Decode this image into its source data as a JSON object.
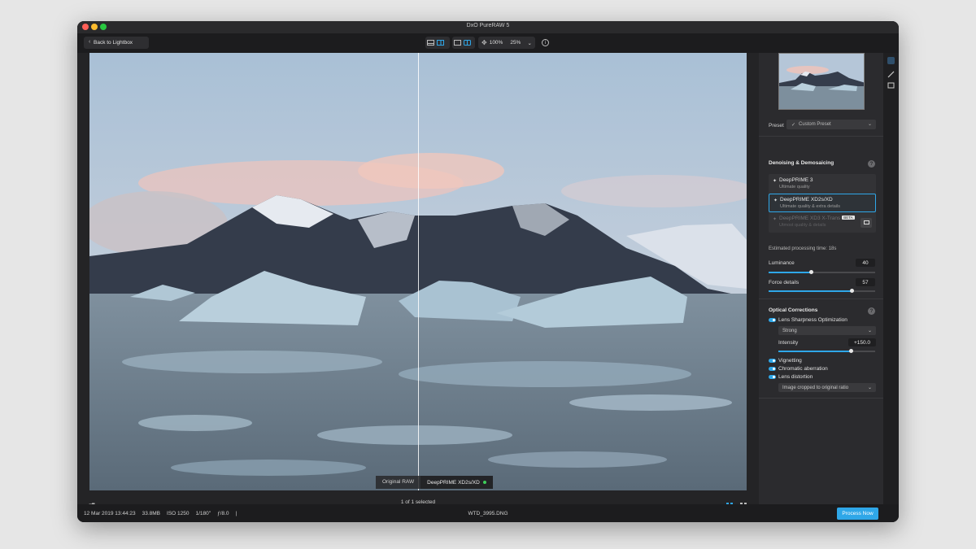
{
  "app": {
    "title": "DxO PureRAW 5"
  },
  "toolbar": {
    "back_label": "Back to Lightbox",
    "zoom_percent": "100%",
    "zoom_select": "25%"
  },
  "viewer": {
    "label_original": "Original RAW",
    "label_processed": "DeepPRIME XD2s/XD",
    "selection_count": "1 of 1 selected"
  },
  "panel": {
    "preset": {
      "label": "Preset",
      "value": "Custom Preset"
    },
    "denoising": {
      "title": "Denoising & Demosaicing",
      "options": [
        {
          "name": "DeepPRIME 3",
          "sub": "Ultimate quality"
        },
        {
          "name": "DeepPRIME XD2s/XD",
          "sub": "Ultimate quality & extra details"
        },
        {
          "name": "DeepPRIME XD3 X-Trans",
          "sub": "Utmost quality & details",
          "badge": "BETA"
        }
      ],
      "estimated_time_label": "Estimated processing time:",
      "estimated_time_value": "18s",
      "luminance": {
        "label": "Luminance",
        "value": "40",
        "fraction": 0.4
      },
      "force_details": {
        "label": "Force details",
        "value": "57",
        "fraction": 0.78
      }
    },
    "optical": {
      "title": "Optical Corrections",
      "lens_sharpness": {
        "label": "Lens Sharpness Optimization",
        "enabled": true,
        "mode": "Strong"
      },
      "intensity": {
        "label": "Intensity",
        "value": "+150.0",
        "fraction": 0.75
      },
      "vignetting": {
        "label": "Vignetting",
        "enabled": true
      },
      "chromatic": {
        "label": "Chromatic aberration",
        "enabled": true
      },
      "distortion": {
        "label": "Lens distortion",
        "enabled": true,
        "mode": "Image cropped to original ratio"
      }
    }
  },
  "status": {
    "date": "12 Mar 2019 13:44:23",
    "size": "33.8MB",
    "iso": "ISO 1250",
    "shutter": "1/180\"",
    "aperture": "ƒ/8.0",
    "separator": "|",
    "filename": "WTD_3995.DNG",
    "process_label": "Process Now"
  },
  "colors": {
    "accent": "#2fa7e8",
    "panel": "#2b2b2e",
    "background": "#1c1c1e"
  },
  "icons": [
    "chevron-left-icon",
    "single-view-icon",
    "split-view-icon",
    "side-by-side-icon",
    "compare-icon",
    "move-icon",
    "chevron-down-icon",
    "info-icon",
    "help-icon",
    "chat-icon",
    "grid-icon",
    "checkmark-icon"
  ]
}
